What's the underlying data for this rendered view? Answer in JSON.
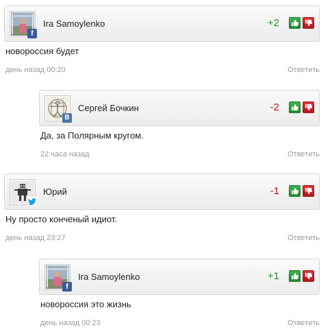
{
  "comments": [
    {
      "author": "Ira Samoylenko",
      "network": "facebook",
      "network_badge": "f",
      "rating": "+2",
      "text": "новороссия будет",
      "time": "день назад 00:20",
      "reply_label": "Ответить"
    },
    {
      "author": "Сергей Бочкин",
      "network": "vkontakte",
      "network_badge": "B",
      "rating": "-2",
      "text": "Да, за Полярным кругом.",
      "time": "22 часа назад",
      "reply_label": "Ответить"
    },
    {
      "author": "Юрий",
      "network": "twitter",
      "network_badge": "",
      "rating": "-1",
      "text": "Ну просто конченый идиот.",
      "time": "день назад 23:27",
      "reply_label": "Ответить"
    },
    {
      "author": "Ira Samoylenko",
      "network": "facebook",
      "network_badge": "f",
      "rating": "+1",
      "text": "новороссия это жизнь",
      "time": "день назад 00:23",
      "reply_label": "Ответить"
    }
  ],
  "icons": {
    "like": "thumbs-up-icon",
    "dislike": "thumbs-down-icon"
  },
  "colors": {
    "positive": "#2a8a2a",
    "negative": "#c0141a",
    "facebook": "#3b5998",
    "vkontakte": "#4c75a3",
    "twitter": "#1da1f2"
  }
}
